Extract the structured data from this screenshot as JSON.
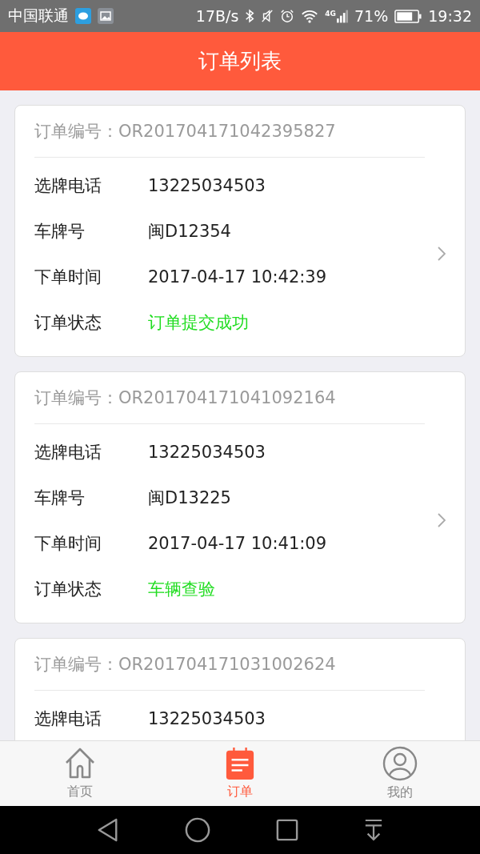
{
  "status_bar": {
    "carrier": "中国联通",
    "speed": "17B/s",
    "network": "4G",
    "battery": "71%",
    "time": "19:32"
  },
  "header": {
    "title": "订单列表"
  },
  "orders": [
    {
      "number_label": "订单编号：",
      "number": "OR201704171042395827",
      "chevron": true,
      "rows": [
        {
          "kind": "text",
          "label": "选牌电话",
          "value": "13225034503"
        },
        {
          "kind": "text",
          "label": "车牌号",
          "value": "闽D12354"
        },
        {
          "kind": "text",
          "label": "下单时间",
          "value": "2017-04-17 10:42:39"
        },
        {
          "kind": "status",
          "label": "订单状态",
          "value": "订单提交成功"
        }
      ]
    },
    {
      "number_label": "订单编号：",
      "number": "OR201704171041092164",
      "chevron": true,
      "rows": [
        {
          "kind": "text",
          "label": "选牌电话",
          "value": "13225034503"
        },
        {
          "kind": "text",
          "label": "车牌号",
          "value": "闽D13225"
        },
        {
          "kind": "text",
          "label": "下单时间",
          "value": "2017-04-17 10:41:09"
        },
        {
          "kind": "status",
          "label": "订单状态",
          "value": "车辆查验"
        }
      ]
    },
    {
      "number_label": "订单编号：",
      "number": "OR201704171031002624",
      "chevron": false,
      "rows": [
        {
          "kind": "text",
          "label": "选牌电话",
          "value": "13225034503"
        }
      ]
    }
  ],
  "tabs": [
    {
      "label": "首页",
      "selected": false
    },
    {
      "label": "订单",
      "selected": true
    },
    {
      "label": "我的",
      "selected": false
    }
  ]
}
